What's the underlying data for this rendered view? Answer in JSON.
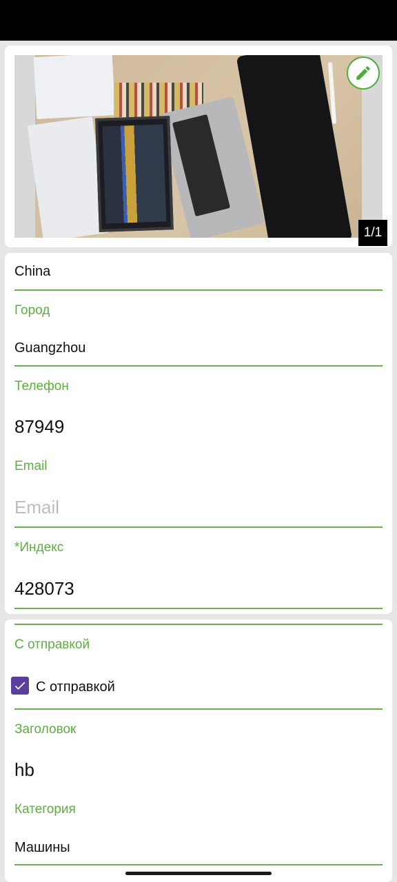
{
  "photo": {
    "counter": "1/1",
    "edit_icon": "pencil-icon"
  },
  "address": {
    "country_value": "China",
    "city_label": "Город",
    "city_value": "Guangzhou",
    "phone_label": "Телефон",
    "phone_value": "87949",
    "email_label": "Email",
    "email_placeholder": "Email",
    "zip_label": "*Индекс",
    "zip_value": "428073"
  },
  "post": {
    "shipping_label": "С отправкой",
    "shipping_checkbox_label": "С отправкой",
    "shipping_checked": true,
    "title_label": "Заголовок",
    "title_value": "hb",
    "category_label": "Категория",
    "category_value": "Машины"
  },
  "colors": {
    "accent_green": "#5daf3f",
    "checkbox_purple": "#5b3f9c"
  }
}
